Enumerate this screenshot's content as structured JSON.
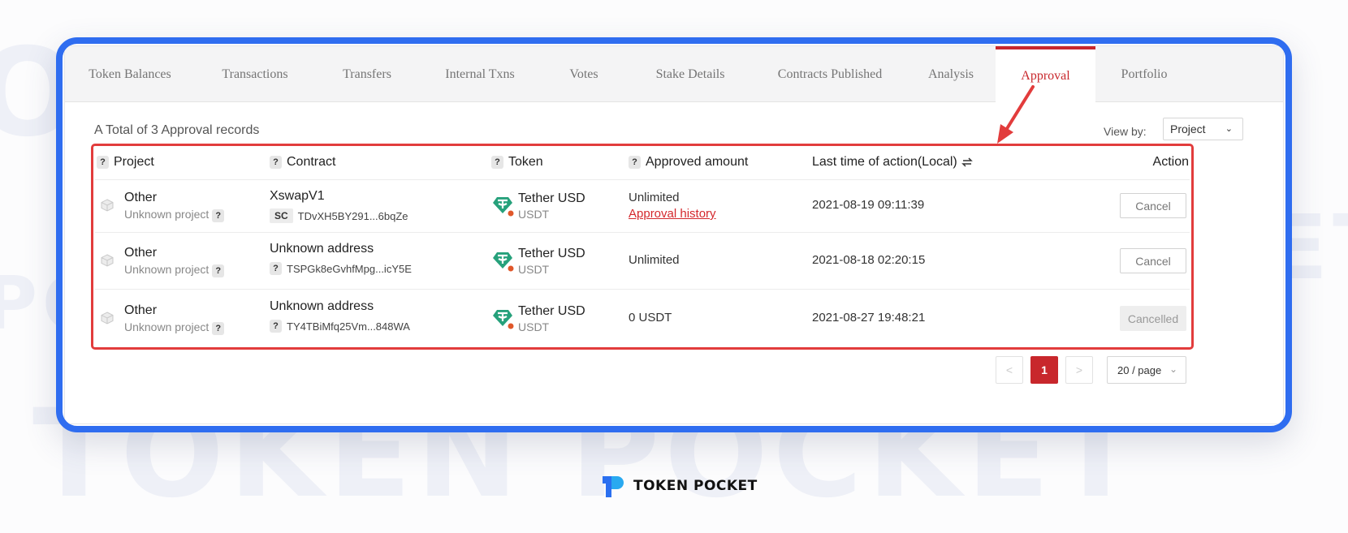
{
  "watermark": {
    "text": "TOKEN POCKET"
  },
  "tabs": [
    {
      "label": "Token Balances",
      "active": false
    },
    {
      "label": "Transactions",
      "active": false
    },
    {
      "label": "Transfers",
      "active": false
    },
    {
      "label": "Internal Txns",
      "active": false
    },
    {
      "label": "Votes",
      "active": false
    },
    {
      "label": "Stake Details",
      "active": false
    },
    {
      "label": "Contracts Published",
      "active": false
    },
    {
      "label": "Analysis",
      "active": false
    },
    {
      "label": "Approval",
      "active": true
    },
    {
      "label": "Portfolio",
      "active": false
    }
  ],
  "summary": {
    "total_text": "A Total of 3 Approval records"
  },
  "view_by": {
    "label": "View by:",
    "selected": "Project"
  },
  "table": {
    "headers": {
      "project": "Project",
      "contract": "Contract",
      "token": "Token",
      "approved_amount": "Approved amount",
      "last_time": "Last time of action(Local)",
      "action": "Action"
    },
    "question_mark": "?",
    "rows": [
      {
        "project_name": "Other",
        "project_sub": "Unknown project",
        "contract_name": "XswapV1",
        "contract_tag": "SC",
        "contract_address": "TDvXH5BY291...6bqZe",
        "token_name": "Tether USD",
        "token_symbol": "USDT",
        "amount": "Unlimited",
        "history_link": "Approval history",
        "time": "2021-08-19 09:11:39",
        "action": "Cancel",
        "action_state": "active"
      },
      {
        "project_name": "Other",
        "project_sub": "Unknown project",
        "contract_name": "Unknown address",
        "contract_tag": "?",
        "contract_address": "TSPGk8eGvhfMpg...icY5E",
        "token_name": "Tether USD",
        "token_symbol": "USDT",
        "amount": "Unlimited",
        "history_link": "",
        "time": "2021-08-18 02:20:15",
        "action": "Cancel",
        "action_state": "active"
      },
      {
        "project_name": "Other",
        "project_sub": "Unknown project",
        "contract_name": "Unknown address",
        "contract_tag": "?",
        "contract_address": "TY4TBiMfq25Vm...848WA",
        "token_name": "Tether USD",
        "token_symbol": "USDT",
        "amount": "0 USDT",
        "history_link": "",
        "time": "2021-08-27 19:48:21",
        "action": "Cancelled",
        "action_state": "disabled"
      }
    ]
  },
  "pagination": {
    "prev": "<",
    "current": "1",
    "next": ">",
    "page_size": "20 / page"
  },
  "brand": {
    "name": "TOKEN POCKET"
  },
  "colors": {
    "accent": "#c8272c",
    "frame": "#2f6df0",
    "highlight": "#e23c3c",
    "tether": "#26a17b"
  }
}
